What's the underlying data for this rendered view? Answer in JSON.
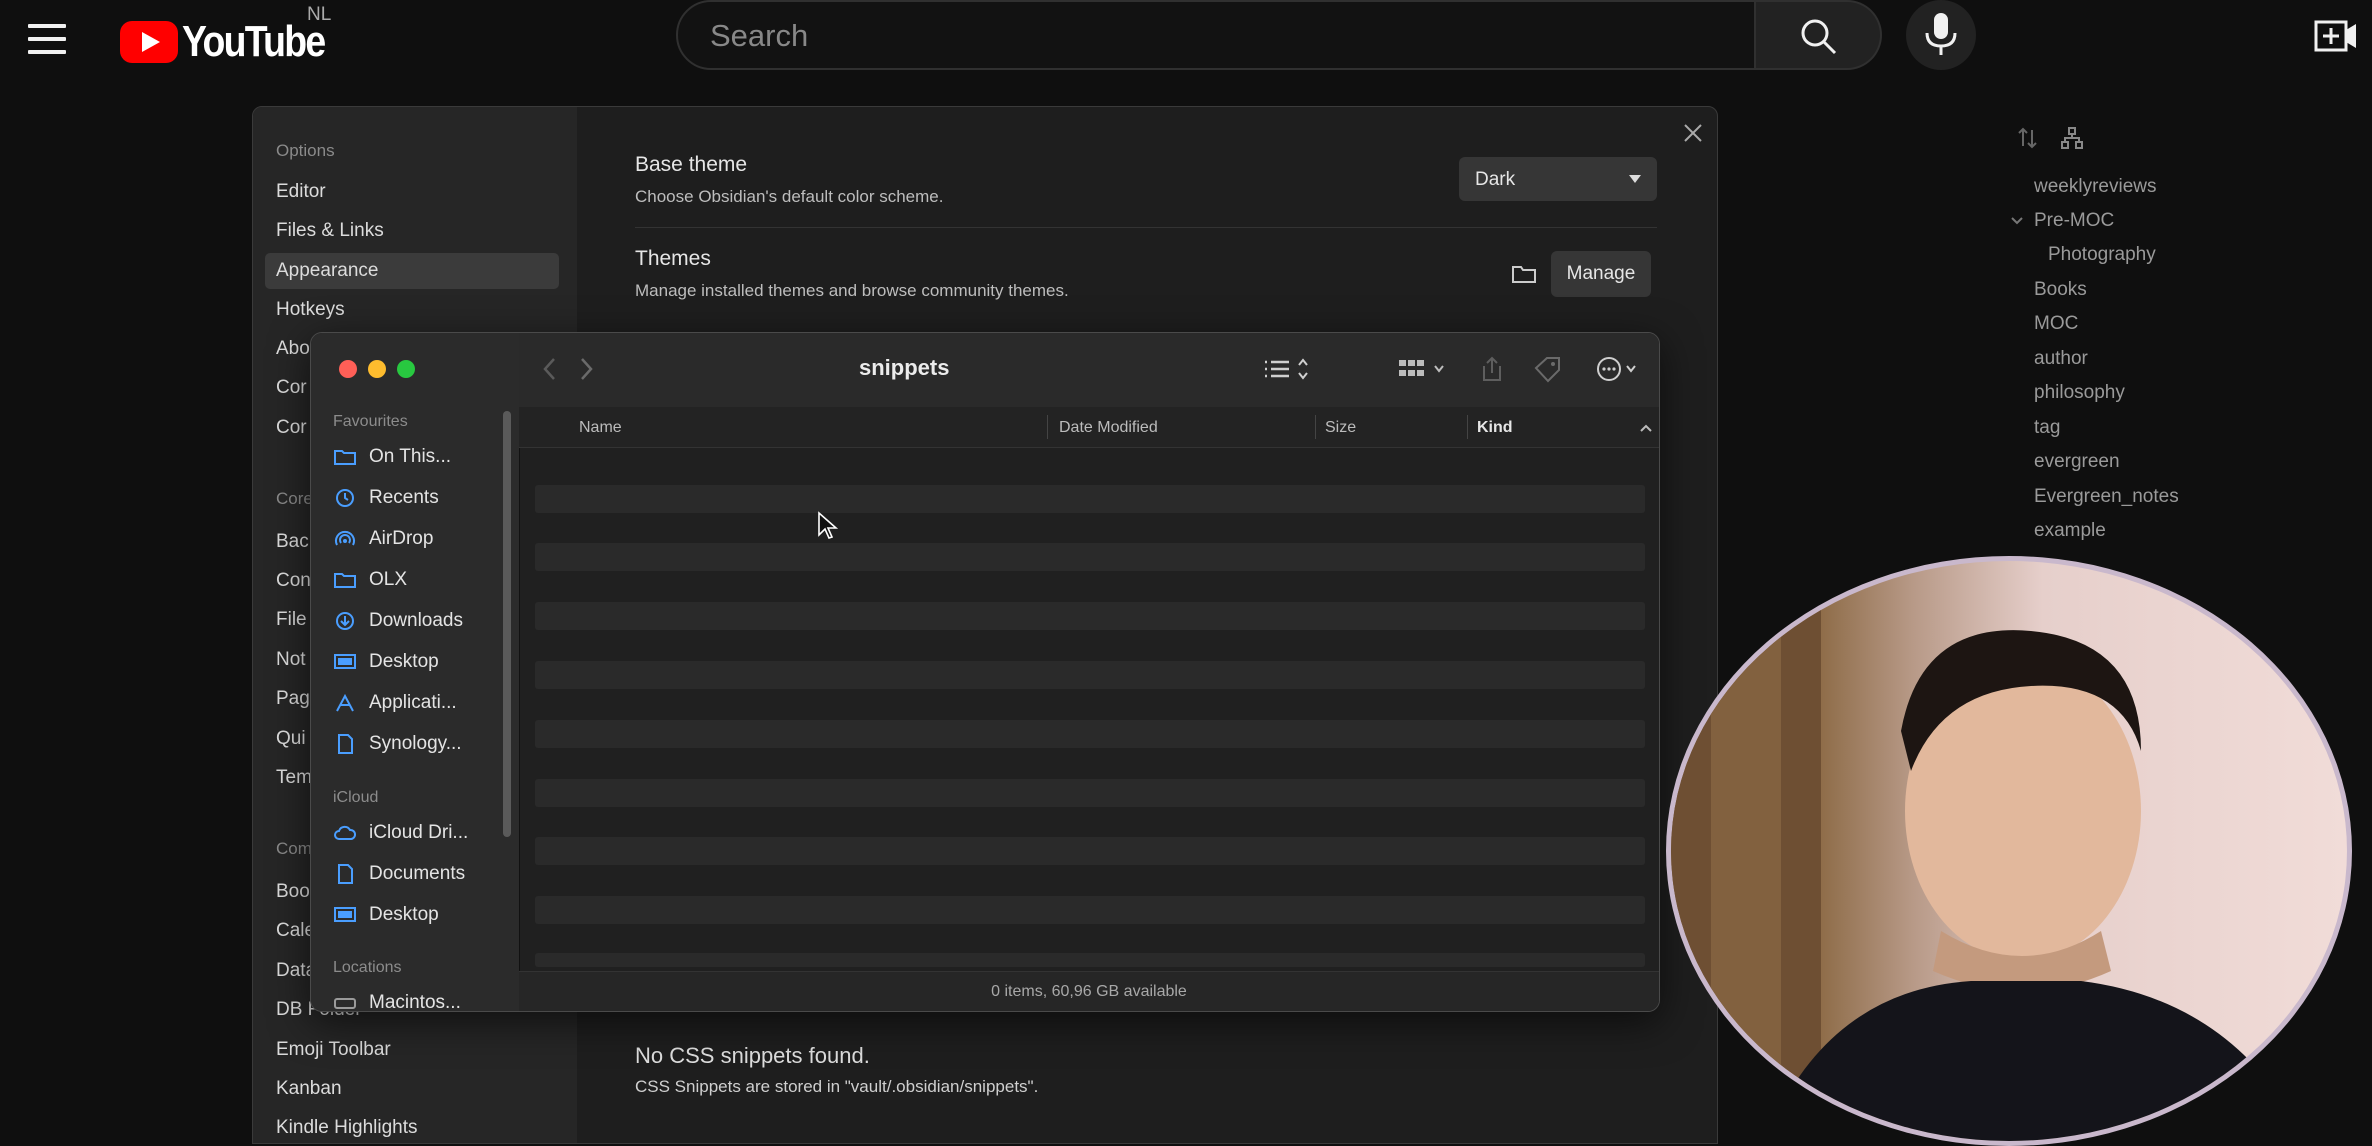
{
  "youtube": {
    "logo_text": "YouTube",
    "country": "NL",
    "search_placeholder": "Search",
    "icons": [
      "menu-icon",
      "search-icon",
      "mic-icon",
      "create-video-icon"
    ]
  },
  "obsidian_tree": {
    "items": [
      "weeklyreviews",
      "Pre-MOC",
      "Photography",
      "Books",
      "MOC",
      "author",
      "philosophy",
      "tag",
      "evergreen",
      "Evergreen_notes",
      "example"
    ]
  },
  "settings": {
    "nav": {
      "options_heading": "Options",
      "items": [
        "Editor",
        "Files & Links",
        "Appearance",
        "Hotkeys",
        "Abo",
        "Cor",
        "Cor"
      ],
      "core_heading": "Core",
      "core_items": [
        "Bac",
        "Con",
        "File",
        "Not",
        "Pag",
        "Qui",
        "Tem"
      ],
      "community_heading": "Com",
      "community_items": [
        "Boo",
        "Cale",
        "Data",
        "DB Folder",
        "Emoji Toolbar",
        "Kanban",
        "Kindle Highlights"
      ]
    },
    "base_theme": {
      "title": "Base theme",
      "desc": "Choose Obsidian's default color scheme.",
      "value": "Dark"
    },
    "themes": {
      "title": "Themes",
      "desc": "Manage installed themes and browse community themes.",
      "manage_label": "Manage"
    },
    "snippets": {
      "empty_title": "No CSS snippets found.",
      "empty_desc": "CSS Snippets are stored in \"vault/.obsidian/snippets\"."
    }
  },
  "finder": {
    "title": "snippets",
    "sidebar": {
      "favourites_heading": "Favourites",
      "favourites": [
        {
          "label": "On This...",
          "icon": "folder-icon"
        },
        {
          "label": "Recents",
          "icon": "clock-icon"
        },
        {
          "label": "AirDrop",
          "icon": "airdrop-icon"
        },
        {
          "label": "OLX",
          "icon": "folder-icon"
        },
        {
          "label": "Downloads",
          "icon": "download-icon"
        },
        {
          "label": "Desktop",
          "icon": "desktop-icon"
        },
        {
          "label": "Applicati...",
          "icon": "applications-icon"
        },
        {
          "label": "Synology...",
          "icon": "document-icon"
        }
      ],
      "icloud_heading": "iCloud",
      "icloud": [
        {
          "label": "iCloud Dri...",
          "icon": "cloud-icon"
        },
        {
          "label": "Documents",
          "icon": "document-icon"
        },
        {
          "label": "Desktop",
          "icon": "desktop-icon"
        }
      ],
      "locations_heading": "Locations",
      "locations": [
        {
          "label": "Macintos...",
          "icon": "disk-icon"
        }
      ]
    },
    "columns": [
      "Name",
      "Date Modified",
      "Size",
      "Kind"
    ],
    "status": "0 items, 60,96 GB available"
  },
  "colors": {
    "youtube_red": "#ff0000",
    "traffic_close": "#ff5f57",
    "traffic_min": "#febc2e",
    "traffic_max": "#28c840",
    "finder_accent": "#4a9eff"
  }
}
